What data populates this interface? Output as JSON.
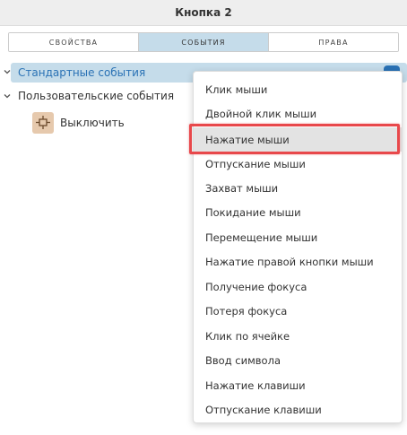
{
  "window": {
    "title": "Кнопка 2"
  },
  "tabs": [
    {
      "label": "СВОЙСТВА",
      "active": false
    },
    {
      "label": "СОБЫТИЯ",
      "active": true
    },
    {
      "label": "ПРАВА",
      "active": false
    }
  ],
  "tree": {
    "standard_events": {
      "label": "Стандартные события",
      "expanded": true
    },
    "user_events": {
      "label": "Пользовательские события",
      "expanded": true
    },
    "action": {
      "label": "Выключить",
      "icon": "flowchart-node-icon"
    }
  },
  "context_menu": {
    "highlighted_index": 2,
    "items": [
      "Клик мыши",
      "Двойной клик мыши",
      "Нажатие мыши",
      "Отпускание мыши",
      "Захват мыши",
      "Покидание мыши",
      "Перемещение мыши",
      "Нажатие правой кнопки мыши",
      "Получение фокуса",
      "Потеря фокуса",
      "Клик по ячейке",
      "Ввод символа",
      "Нажатие клавиши",
      "Отпускание клавиши"
    ]
  },
  "colors": {
    "accent": "#2a72b5",
    "selected_bg": "#c5dcea",
    "highlight_border": "#e8484b"
  }
}
